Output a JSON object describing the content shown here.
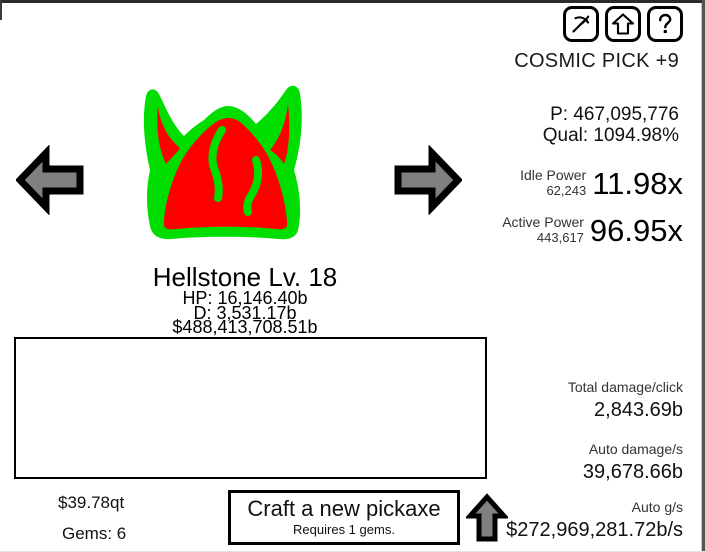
{
  "toolbar": {
    "buttons": [
      {
        "name": "pickaxe-button",
        "icon": "pickaxe-icon",
        "label": "Pickaxe"
      },
      {
        "name": "upgrade-button",
        "icon": "up-arrow-icon",
        "label": "Upgrade"
      },
      {
        "name": "help-button",
        "icon": "question-mark-icon",
        "label": "Help"
      }
    ]
  },
  "pickaxe": {
    "title": "COSMIC PICK +9",
    "power_line": "P: 467,095,776",
    "quality_line": "Qual: 1094.98%"
  },
  "power": {
    "idle": {
      "label": "Idle Power",
      "value": "62,243",
      "multiplier": "11.98x"
    },
    "active": {
      "label": "Active Power",
      "value": "443,617",
      "multiplier": "96.95x"
    }
  },
  "stats": {
    "total_damage_click": {
      "label": "Total damage/click",
      "value": "2,843.69b"
    },
    "auto_damage": {
      "label": "Auto damage/s",
      "value": "39,678.66b"
    },
    "auto_gold": {
      "label": "Auto g/s",
      "value": "$272,969,281.72b/s"
    }
  },
  "monster": {
    "name": "Hellstone Lv. 18",
    "hp": "HP: 16,146.40b",
    "damage": "D: 3,531.17b",
    "gold": "$488,413,708.51b",
    "sprite": "hellstone-sprite",
    "body_color": "#ff0000",
    "outline_color": "#00dd00"
  },
  "navigation": {
    "prev_label": "Previous monster",
    "next_label": "Next monster"
  },
  "currency": {
    "money": "$39.78qt",
    "gems": "Gems: 6"
  },
  "craft": {
    "main_label": "Craft a new pickaxe",
    "sub_label": "Requires 1 gems.",
    "arrow_label": "Upgrade pickaxe"
  }
}
